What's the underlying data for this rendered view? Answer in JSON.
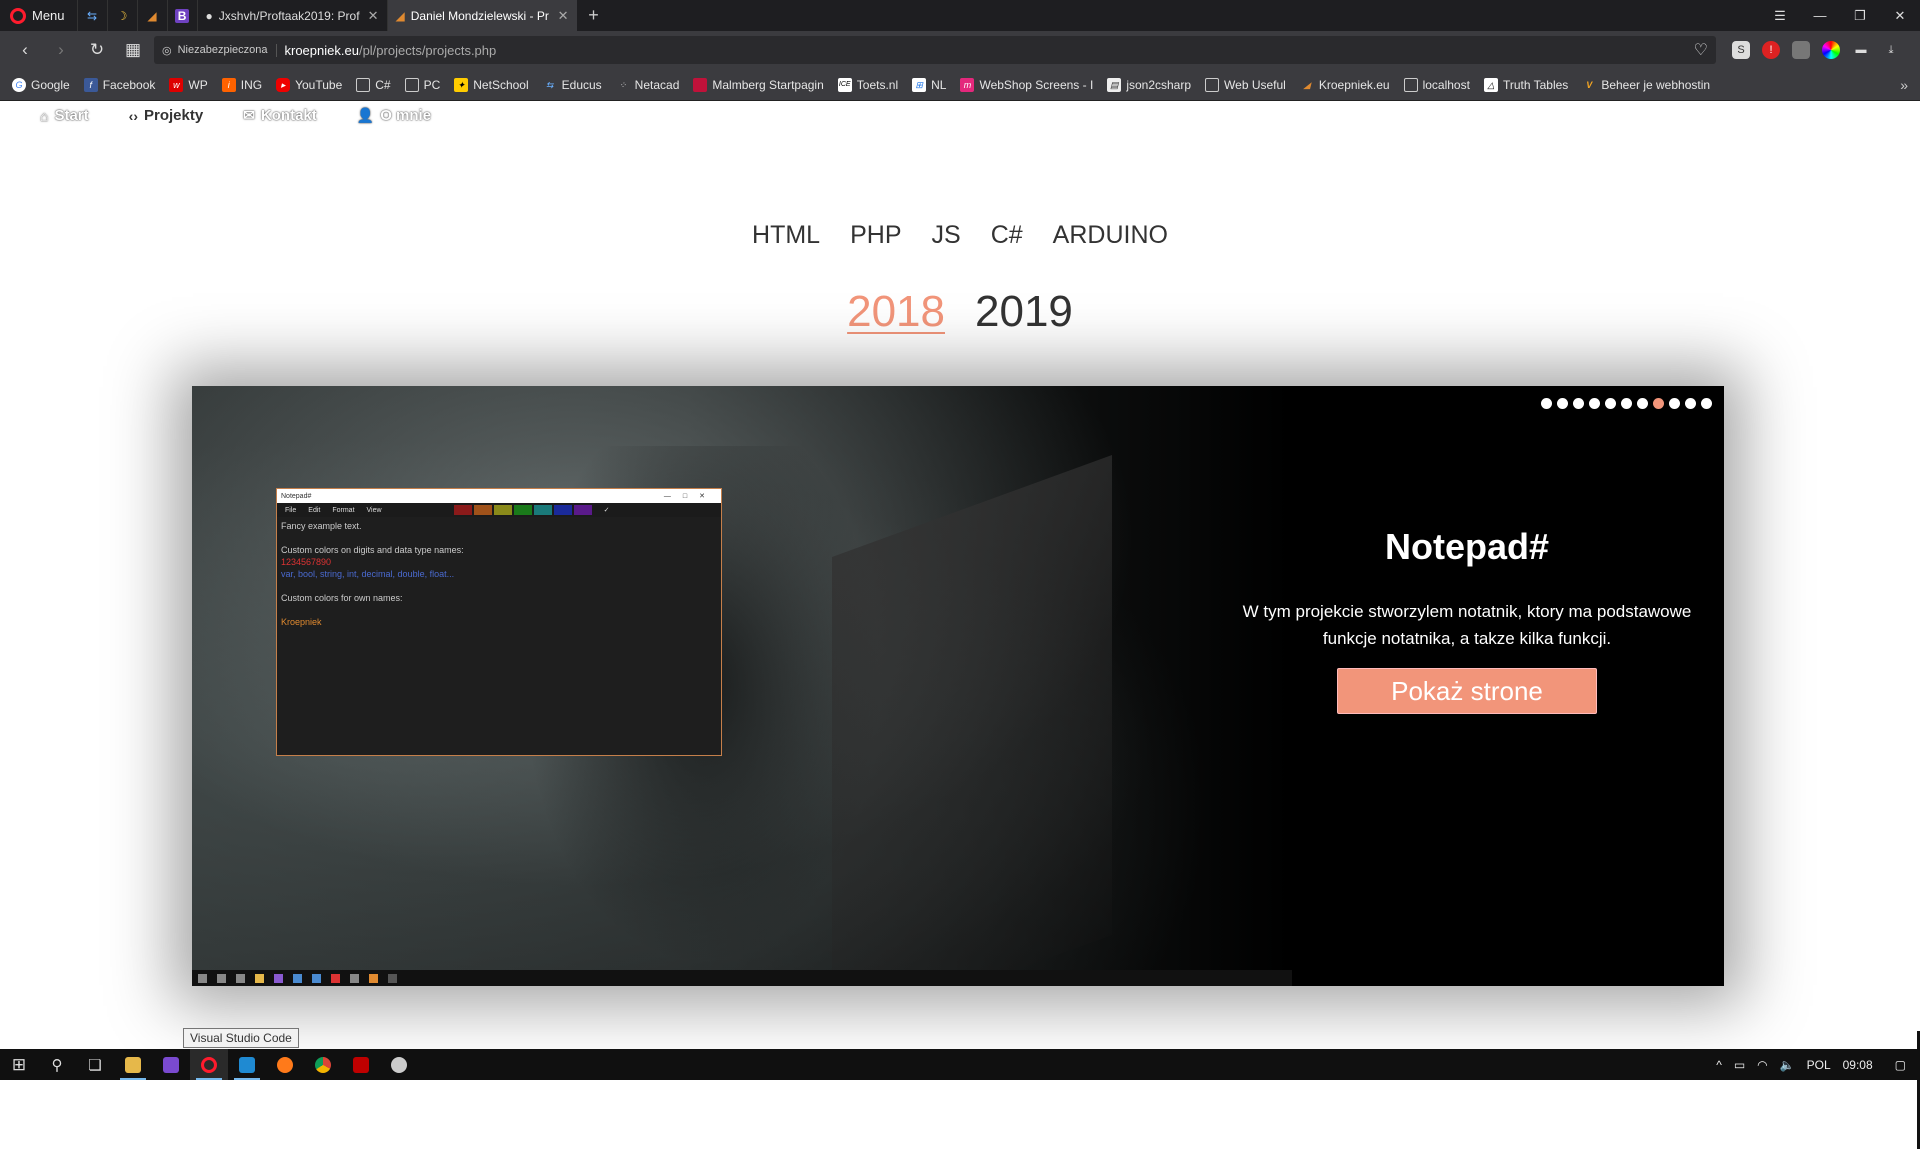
{
  "browser": {
    "menu_label": "Menu",
    "tabs": [
      {
        "title": "Jxshvh/Proftaak2019: Prof",
        "close": "✕"
      },
      {
        "title": "Daniel Mondzielewski - Pr",
        "close": "✕"
      }
    ],
    "new_tab": "+",
    "address": {
      "security_label": "Niezabezpieczona",
      "host": "kroepniek.eu",
      "path": "/pl/projects/projects.php"
    },
    "bookmarks": [
      "Google",
      "Facebook",
      "WP",
      "ING",
      "YouTube",
      "C#",
      "PC",
      "NetSchool",
      "Educus",
      "Netacad",
      "Malmberg Startpagin",
      "Toets.nl",
      "NL",
      "WebShop Screens - I",
      "json2csharp",
      "Web Useful",
      "Kroepniek.eu",
      "localhost",
      "Truth Tables",
      "Beheer je webhostin"
    ]
  },
  "site_nav": {
    "items": [
      {
        "label": "Start",
        "icon": "home-icon"
      },
      {
        "label": "Projekty",
        "icon": "code-icon"
      },
      {
        "label": "Kontakt",
        "icon": "mail-icon"
      },
      {
        "label": "O mnie",
        "icon": "user-icon"
      }
    ]
  },
  "categories": [
    "HTML",
    "PHP",
    "JS",
    "C#",
    "ARDUINO"
  ],
  "years": [
    "2018",
    "2019"
  ],
  "slider": {
    "title": "Notepad#",
    "description": "W tym projekcie stworzylem notatnik, ktory ma podstawowe funkcje notatnika, a takze kilka funkcji.",
    "button": "Pokaż strone",
    "dot_count": 11,
    "active_dot": 7
  },
  "notepad_preview": {
    "window_title": "Notepad#",
    "menu": [
      "File",
      "Edit",
      "Format",
      "View"
    ],
    "lines": [
      "Fancy example text.",
      "",
      "Custom colors on digits and data type names:",
      "1234567890",
      "var, bool, string, int, decimal, double, float...",
      "",
      "Custom colors for own names:",
      "",
      "Kroepniek",
      ""
    ]
  },
  "tooltip": "Visual Studio Code",
  "taskbar": {
    "language": "POL",
    "time": "09:08"
  },
  "colors": {
    "accent": "#f2957a"
  }
}
